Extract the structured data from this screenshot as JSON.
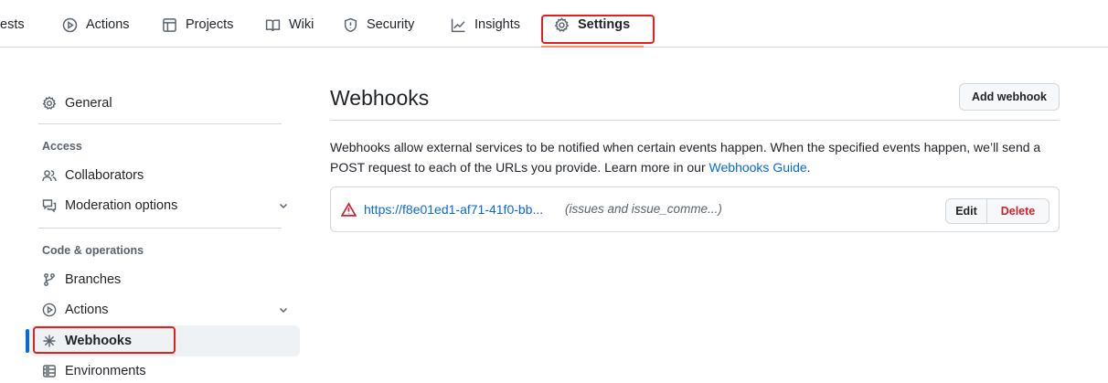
{
  "topnav": {
    "tabs": [
      {
        "label": "ests",
        "icon": "none"
      },
      {
        "label": "Actions",
        "icon": "play-circle-icon"
      },
      {
        "label": "Projects",
        "icon": "table-icon"
      },
      {
        "label": "Wiki",
        "icon": "book-icon"
      },
      {
        "label": "Security",
        "icon": "shield-icon"
      },
      {
        "label": "Insights",
        "icon": "graph-icon"
      },
      {
        "label": "Settings",
        "icon": "gear-icon",
        "selected": true
      }
    ],
    "accent_color": "#fd8c73",
    "highlight_color": "#e3201b"
  },
  "sidebar": {
    "general": {
      "label": "General",
      "icon": "gear-icon"
    },
    "access": {
      "heading": "Access",
      "items": [
        {
          "label": "Collaborators",
          "icon": "people-icon"
        },
        {
          "label": "Moderation options",
          "icon": "comment-discussion-icon",
          "expandable": true
        }
      ]
    },
    "code_operations": {
      "heading": "Code & operations",
      "items": [
        {
          "label": "Branches",
          "icon": "git-branch-icon"
        },
        {
          "label": "Actions",
          "icon": "play-circle-icon",
          "expandable": true
        },
        {
          "label": "Webhooks",
          "icon": "webhook-icon",
          "active": true
        },
        {
          "label": "Environments",
          "icon": "server-icon"
        }
      ]
    },
    "active_color": "#0969da"
  },
  "main": {
    "title": "Webhooks",
    "add_button": "Add webhook",
    "description": "Webhooks allow external services to be notified when certain events happen. When the specified events happen, we’ll send a POST request to each of the URLs you provide. Learn more in our ",
    "guide_link": "Webhooks Guide",
    "description_end": ".",
    "webhook": {
      "status_icon": "alert-icon",
      "url": "https://f8e01ed1-af71-41f0-bb...",
      "events": "(issues and issue_comme...)",
      "edit_label": "Edit",
      "delete_label": "Delete"
    },
    "link_color": "#0969da",
    "danger_color": "#cf222e"
  }
}
